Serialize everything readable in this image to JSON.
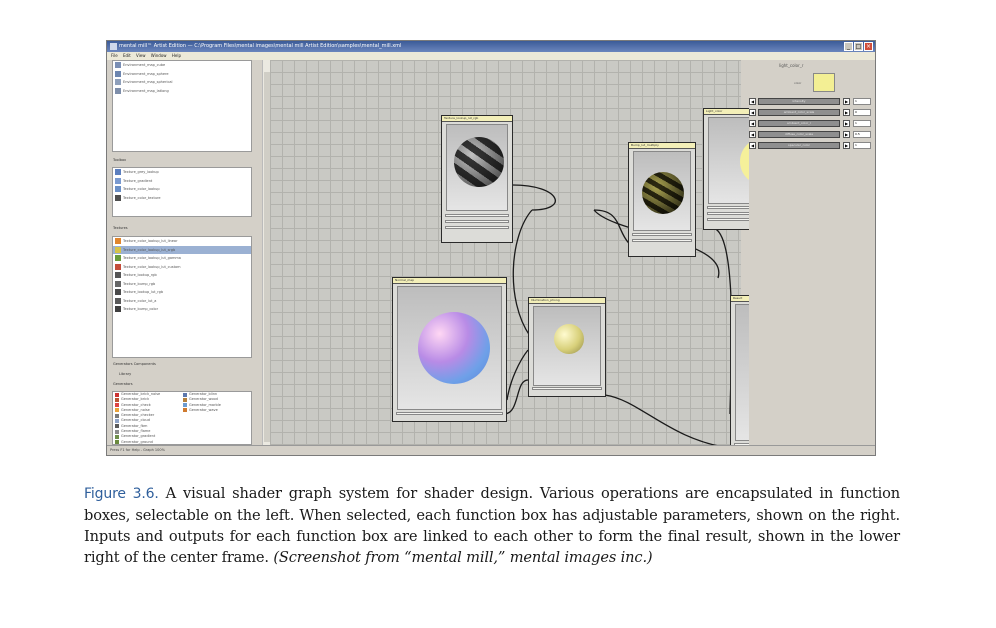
{
  "screenshot": {
    "title_bar": "mental mill™ Artist Edition — C:\\Program Files\\mental images\\mental mill Artist Edition\\samples\\mental_mill.xml",
    "menu_items": [
      "File",
      "Edit",
      "View",
      "Window",
      "Help"
    ],
    "window_buttons": [
      "_",
      "□",
      "×"
    ],
    "left_panel": {
      "top_items": [
        "Environment_map_cube",
        "Environment_map_sphere",
        "Environment_map_spherical",
        "Environment_map_latlong"
      ],
      "section_1_header": "Toolbox",
      "section_1_items": [
        "Texture_grey_lookup",
        "Texture_gradient",
        "Texture_color_lookup",
        "Texture_color_texture"
      ],
      "section_2_header": "Textures",
      "section_2_items": [
        "Texture_color_lookup_lut_linear",
        "Texture_color_lookup_lut_srgb",
        "Texture_color_lookup_lut_gamma",
        "Texture_color_lookup_lut_custom",
        "Texture_lookup_rgb",
        "Texture_bump_rgb",
        "Texture_lookup_lut_rgb",
        "Texture_color_lut_a",
        "Texture_bump_color"
      ],
      "section_3_header": "Generators Components",
      "section_3_sub": "Library",
      "section_4_header": "Generators",
      "section_4_items": [
        "Generator_brick_noise",
        "Generator_brick",
        "Generator_check",
        "Generator_noise",
        "Generator_checker",
        "Generator_cloud",
        "Generator_fbm",
        "Generator_flame",
        "Generator_gradient",
        "Generator_ground"
      ],
      "section_4_items_b": [
        "Generator_blinn",
        "Generator_wood",
        "Generator_marble",
        "Generator_wave"
      ]
    },
    "nodes": [
      {
        "title": "Texture_lookup_lut_rgb"
      },
      {
        "title": "Normal_map"
      },
      {
        "title": "Illumination_phong"
      },
      {
        "title": "Bump_lut_multiply"
      },
      {
        "title": "Light_color"
      },
      {
        "title": "Result"
      }
    ],
    "right_panel": {
      "node_name": "light_color_r",
      "swatch_label": "color",
      "params": [
        {
          "label": "intensity",
          "value": "1"
        },
        {
          "label": "ambient_color_scale",
          "value": "0"
        },
        {
          "label": "ambient_color_r",
          "value": "1"
        },
        {
          "label": "diffuse_color_scale",
          "value": "0.5"
        },
        {
          "label": "specular_color",
          "value": "1"
        }
      ],
      "swatch_color": "#f3ef94"
    },
    "status_bar": "Press F1 for Help - Graph 100%"
  },
  "caption": {
    "label": "Figure 3.6.",
    "text": "A visual shader graph system for shader design. Various operations are encapsulated in function boxes, selectable on the left. When selected, each function box has adjustable parameters, shown on the right. Inputs and outputs for each function box are linked to each other to form the final result, shown in the lower right of the center frame.",
    "credit": "(Screenshot from “mental mill,” mental images inc.)"
  },
  "colors": {
    "caption_label": "#2f5f9c",
    "node_header": "#f3efb8",
    "selection": "#9bb1d3"
  }
}
